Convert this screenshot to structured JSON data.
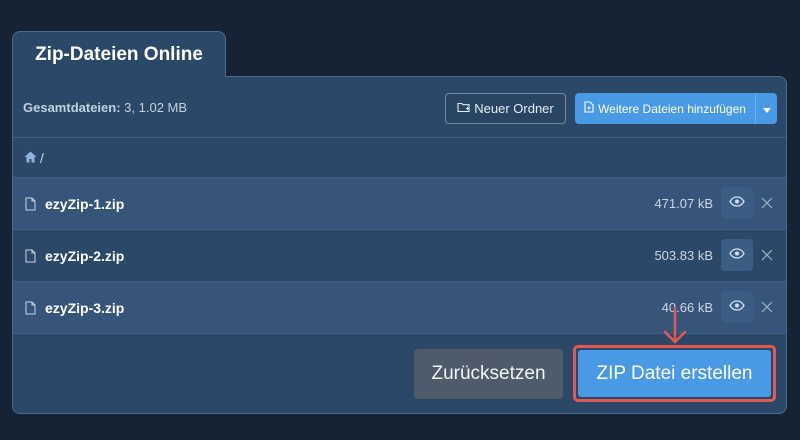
{
  "tab": {
    "title": "Zip-Dateien Online"
  },
  "toolbar": {
    "summary_label": "Gesamtdateien:",
    "summary_value": "3, 1.02 MB",
    "new_folder_label": "Neuer Ordner",
    "add_files_label": "Weitere Dateien hinzufügen"
  },
  "breadcrumb": {
    "separator": "/"
  },
  "files": [
    {
      "name": "ezyZip-1.zip",
      "size": "471.07 kB"
    },
    {
      "name": "ezyZip-2.zip",
      "size": "503.83 kB"
    },
    {
      "name": "ezyZip-3.zip",
      "size": "40.66 kB"
    }
  ],
  "footer": {
    "reset_label": "Zurücksetzen",
    "create_label": "ZIP Datei erstellen"
  },
  "colors": {
    "background": "#152335",
    "panel": "#2c4868",
    "accent": "#4a99e4",
    "highlight": "#e05a55"
  }
}
